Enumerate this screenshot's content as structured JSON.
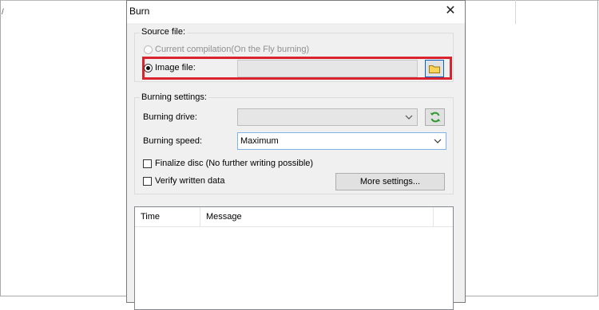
{
  "background": {
    "glyph": "/"
  },
  "dialog": {
    "title": "Burn",
    "close_icon": "✕",
    "source": {
      "legend": "Source file:",
      "option_compilation": "Current compilation(On the Fly burning)",
      "option_image": "Image file:",
      "image_path": ""
    },
    "burning": {
      "legend": "Burning settings:",
      "drive_label": "Burning drive:",
      "drive_value": "",
      "speed_label": "Burning speed:",
      "speed_value": "Maximum",
      "finalize_label": "Finalize disc (No further writing possible)",
      "verify_label": "Verify written data",
      "more_button": "More settings..."
    },
    "log": {
      "columns": [
        "Time",
        "Message"
      ]
    }
  },
  "colors": {
    "highlight": "#d9232e",
    "dialog_bg": "#f0f0f0",
    "active_border": "#7eb4ea"
  }
}
